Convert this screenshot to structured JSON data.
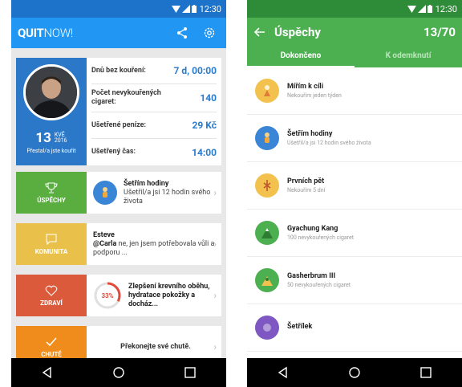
{
  "status": {
    "time": "12:30"
  },
  "left": {
    "logo_bold": "QUIT",
    "logo_light": "NOW!",
    "quit_date": {
      "day": "13",
      "month": "KVĚ",
      "year": "2016",
      "caption": "Přestal/a jste kouřit"
    },
    "stats": [
      {
        "label": "Dnů bez kouření:",
        "value": "7 d, 00:00"
      },
      {
        "label": "Počet nevykouřených cigaret:",
        "value": "140"
      },
      {
        "label": "Ušetřené peníze:",
        "value": "29 Kč"
      },
      {
        "label": "Ušetřený čas:",
        "value": "14:00"
      }
    ],
    "features": [
      {
        "tile": "ÚSPĚCHY",
        "title": "Šetřím hodiny",
        "text": "Ušetřil/a jsi 12 hodin svého života"
      },
      {
        "tile": "KOMUNITA",
        "title": "Esteve",
        "text_prefix": "@Carla",
        "text": " ne, jen jsem potřebovala vůli a podporu ..."
      },
      {
        "tile": "ZDRAVÍ",
        "ring": "33%",
        "text": "Zlepšení krevního oběhu, hydratace pokožky a docház..."
      },
      {
        "tile": "CHUTĚ",
        "text": "Překonejte své chutě."
      }
    ]
  },
  "right": {
    "title": "Úspěchy",
    "count": "13/70",
    "tabs": [
      "Dokončeno",
      "K odemknutí"
    ],
    "achievements": [
      {
        "title": "Mířím k cíli",
        "sub": "Nekouřím jeden týden",
        "color": "#f2c14e"
      },
      {
        "title": "Šetřím hodiny",
        "sub": "Ušetřil/a jsi 12 hodin svého života",
        "color": "#3a85d5"
      },
      {
        "title": "Prvních pět",
        "sub": "Nekouřím 5 dní",
        "color": "#f2c14e"
      },
      {
        "title": "Gyachung Kang",
        "sub": "100 nevykouřených cigaret",
        "color": "#4caf50"
      },
      {
        "title": "Gasherbrum III",
        "sub": "50 nevykouřených cigaret",
        "color": "#4caf50"
      },
      {
        "title": "Šetřílek",
        "sub": "",
        "color": "#7e57c2"
      }
    ]
  },
  "colors": {
    "left_blue": "#2196f3",
    "green": "#4caf50",
    "tile_achievements": "#5aae3f",
    "tile_community": "#e8c04a",
    "tile_health": "#dc5a3c",
    "tile_cravings": "#f08c1c"
  }
}
